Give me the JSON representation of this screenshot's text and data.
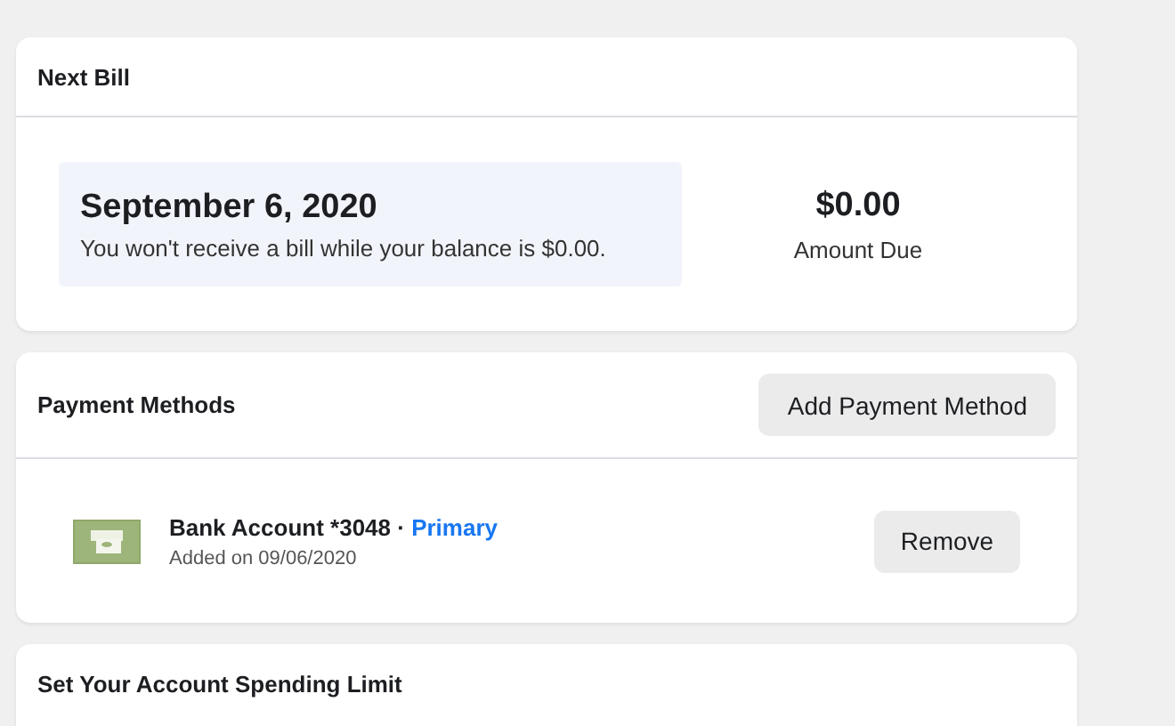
{
  "next_bill": {
    "title": "Next Bill",
    "date": "September 6, 2020",
    "note": "You won't receive a bill while your balance is $0.00.",
    "amount": "$0.00",
    "amount_label": "Amount Due"
  },
  "payment_methods": {
    "title": "Payment Methods",
    "add_button": "Add Payment Method",
    "items": [
      {
        "name": "Bank Account *3048 ·",
        "tag": "Primary",
        "added": "Added on 09/06/2020",
        "button": "Remove"
      }
    ]
  },
  "spending_limit": {
    "title": "Set Your Account Spending Limit"
  }
}
